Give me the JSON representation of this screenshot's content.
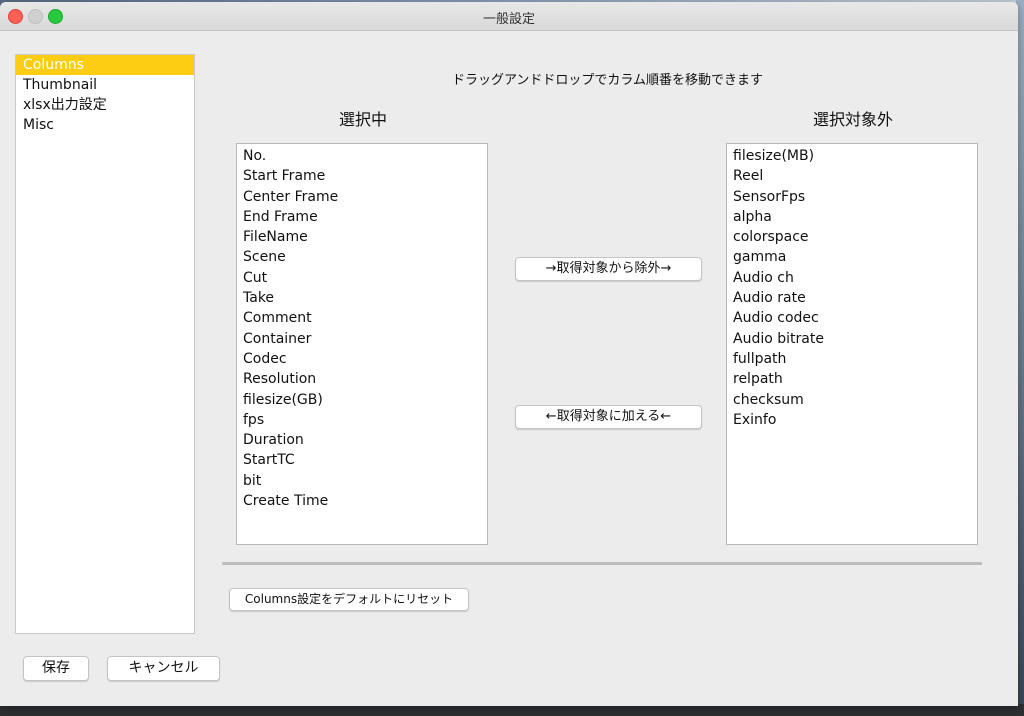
{
  "window": {
    "title": "一般設定"
  },
  "sidebar": {
    "items": [
      {
        "label": "Columns",
        "selected": true
      },
      {
        "label": "Thumbnail",
        "selected": false
      },
      {
        "label": "xlsx出力設定",
        "selected": false
      },
      {
        "label": "Misc",
        "selected": false
      }
    ]
  },
  "columns_panel": {
    "instruction": "ドラッグアンドドロップでカラム順番を移動できます",
    "selected_heading": "選択中",
    "excluded_heading": "選択対象外",
    "selected_items": [
      "No.",
      "Start Frame",
      "Center Frame",
      "End Frame",
      "FileName",
      "Scene",
      "Cut",
      "Take",
      "Comment",
      "Container",
      "Codec",
      "Resolution",
      "filesize(GB)",
      "fps",
      "Duration",
      "StartTC",
      "bit",
      "Create Time"
    ],
    "excluded_items": [
      "filesize(MB)",
      "Reel",
      "SensorFps",
      "alpha",
      "colorspace",
      "gamma",
      "Audio ch",
      "Audio rate",
      "Audio codec",
      "Audio bitrate",
      "fullpath",
      "relpath",
      "checksum",
      "Exinfo"
    ],
    "exclude_button": "→取得対象から除外→",
    "include_button": "←取得対象に加える←",
    "reset_button": "Columns設定をデフォルトにリセット"
  },
  "footer": {
    "save_label": "保存",
    "cancel_label": "キャンセル"
  },
  "colors": {
    "selection": "#fccd12",
    "close": "#fe5f57",
    "maximize": "#28c840"
  }
}
